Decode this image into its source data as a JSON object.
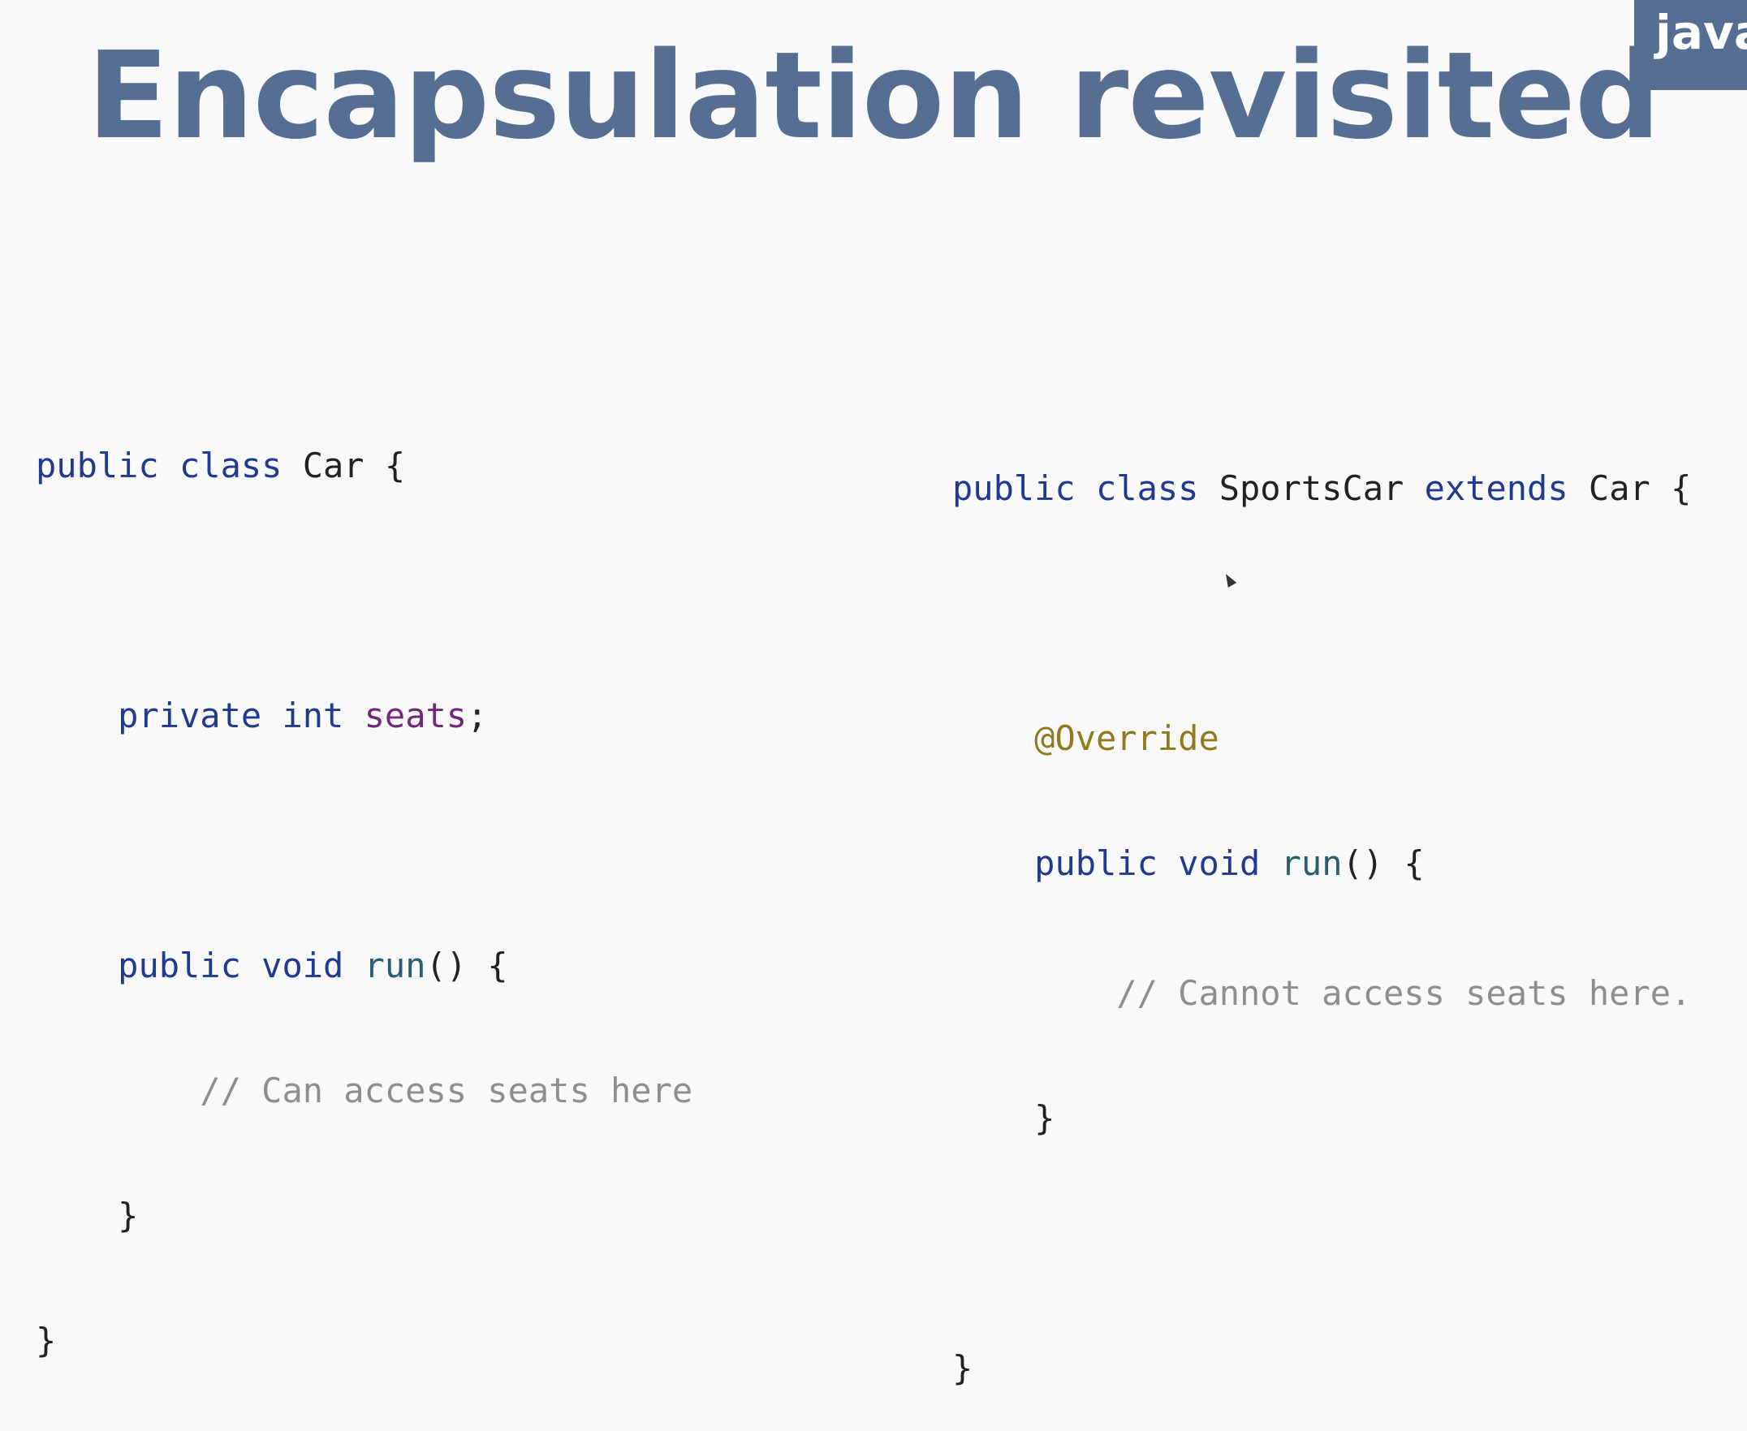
{
  "slide": {
    "title": "Encapsulation revisited",
    "badge": "java"
  },
  "code_left": {
    "l1": {
      "kw": "public class",
      "name": "Car",
      "brace": "{"
    },
    "l2": {
      "mod": "private",
      "type": "int",
      "var": "seats",
      "end": ";"
    },
    "l3": {
      "mod": "public",
      "type": "void",
      "fn": "run",
      "sig": "()",
      "brace": "{"
    },
    "l4": {
      "comment": "// Can access seats here"
    },
    "l5": {
      "brace": "}"
    },
    "l6": {
      "brace": "}"
    }
  },
  "code_right": {
    "l1": {
      "kw": "public class",
      "name": "SportsCar",
      "kw2": "extends",
      "parent": "Car",
      "brace": "{"
    },
    "l2": {
      "annotation": "@Override"
    },
    "l3": {
      "mod": "public",
      "type": "void",
      "fn": "run",
      "sig": "()",
      "brace": "{"
    },
    "l4": {
      "comment": "// Cannot access seats here."
    },
    "l5": {
      "brace": "}"
    },
    "l6": {
      "brace": "}"
    }
  },
  "colors": {
    "title": "#566e92",
    "keyword": "#1f3a8f",
    "method": "#2c5d6f",
    "field": "#6e2a78",
    "annotation": "#8f7a1e",
    "comment": "#8e8e8e"
  },
  "icons": {
    "cursor": "mouse-pointer-icon"
  }
}
